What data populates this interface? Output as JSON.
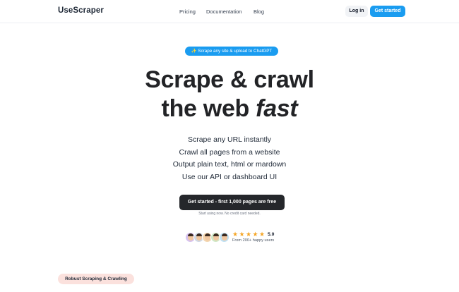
{
  "nav": {
    "logo": "UseScraper",
    "links": [
      "Pricing",
      "Documentation",
      "Blog"
    ],
    "login_label": "Log in",
    "get_started_label": "Get started"
  },
  "hero": {
    "pill": "✨ Scrape any site & upload to ChatGPT",
    "line1": "Scrape & crawl",
    "line2_prefix": "the web ",
    "line2_emphasis": "fast",
    "features": [
      "Scrape any URL instantly",
      "Crawl all pages from a website",
      "Output plain text, html or mardown",
      "Use our API or dashboard UI"
    ],
    "cta_label": "Get started - first 1,000 pages are free",
    "cta_note": "Start using now. No credit card needed."
  },
  "social_proof": {
    "rating": "5.0",
    "star_count": 5,
    "users_text": "From 200+ happy users",
    "star_color": "#f5a524"
  },
  "section": {
    "badge": "Robust Scraping & Crawling"
  },
  "colors": {
    "accent": "#1a9cf0",
    "dark_button": "#25272b",
    "badge_bg": "#fbe1dd"
  }
}
